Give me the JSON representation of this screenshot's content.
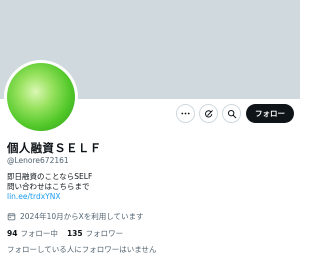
{
  "profile": {
    "display_name": "個人融資ＳＥＬＦ",
    "handle": "@Lenore672161",
    "bio_line1": "即日融資のことならSELF",
    "bio_line2": "問い合わせはこちらまで",
    "bio_link": "lin.ee/trdxYNX",
    "joined": "2024年10月からXを利用しています",
    "following_count": "94",
    "following_label": "フォロー中",
    "followers_count": "135",
    "followers_label": "フォロワー",
    "followed_by_note": "フォローしている人にフォロワーはいません"
  },
  "actions": {
    "follow_label": "フォロー",
    "icons": [
      "more-icon",
      "grok-icon",
      "search-icon"
    ]
  },
  "colors": {
    "banner": "#cfd9de",
    "link": "#1d9bf0",
    "secondary_text": "#536471",
    "follow_button": "#0f1419"
  }
}
